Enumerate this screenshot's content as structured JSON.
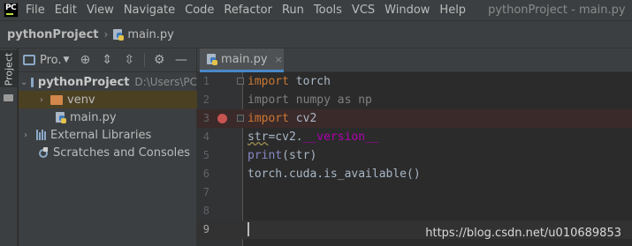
{
  "menubar": {
    "logo_text": "PC",
    "items": [
      "File",
      "Edit",
      "View",
      "Navigate",
      "Code",
      "Refactor",
      "Run",
      "Tools",
      "VCS",
      "Window",
      "Help"
    ],
    "window_title": "pythonProject - main.py"
  },
  "navbar": {
    "project": "pythonProject",
    "separator": "›",
    "file": "main.py"
  },
  "left_stripe": {
    "project_tab": "Project"
  },
  "project_panel": {
    "view_label": "Pro.",
    "tree": {
      "root": {
        "name": "pythonProject",
        "path": "D:\\Users\\PC"
      },
      "venv": "venv",
      "main_file": "main.py",
      "external_libraries": "External Libraries",
      "scratches": "Scratches and Consoles"
    }
  },
  "editor": {
    "tab_label": "main.py",
    "tab_close": "×",
    "line_numbers": [
      "1",
      "2",
      "3",
      "4",
      "5",
      "6",
      "7",
      "8",
      "9"
    ],
    "code": {
      "l1_kw": "import",
      "l1_rest": " torch",
      "l2": "import numpy as np",
      "l3_kw": "import",
      "l3_rest": " cv2",
      "l4_a": "str",
      "l4_b": "=cv2.",
      "l4_c": "__version__",
      "l5_a": "print",
      "l5_b": "(str)",
      "l6": "torch.cuda.is_available()"
    },
    "breakpoint_line": 3,
    "caret_line": 9
  },
  "watermark": "https://blog.csdn.net/u010689853",
  "colors": {
    "keyword": "#cc7832",
    "dunder": "#b200b2",
    "builtin": "#8888c6",
    "breakpoint": "#c75450"
  }
}
